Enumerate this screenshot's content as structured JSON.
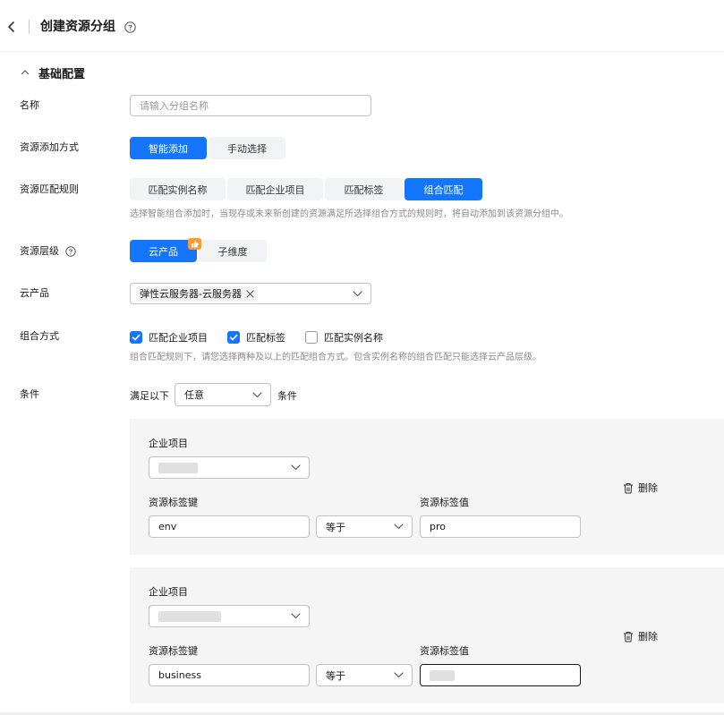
{
  "header": {
    "title": "创建资源分组"
  },
  "section": {
    "title": "基础配置"
  },
  "name": {
    "label": "名称",
    "placeholder": "请输入分组名称"
  },
  "add_method": {
    "label": "资源添加方式",
    "options": [
      "智能添加",
      "手动选择"
    ],
    "selected": "智能添加"
  },
  "match_rule": {
    "label": "资源匹配规则",
    "options": [
      "匹配实例名称",
      "匹配企业项目",
      "匹配标签",
      "组合匹配"
    ],
    "selected": "组合匹配",
    "hint": "选择智能组合添加时，当现存或未来新创建的资源满足所选择组合方式的规则时，将自动添加到该资源分组中。"
  },
  "level": {
    "label": "资源层级",
    "options": [
      "云产品",
      "子维度"
    ],
    "selected": "云产品"
  },
  "cloud_product": {
    "label": "云产品",
    "selected_tag": "弹性云服务器-云服务器"
  },
  "combination": {
    "label": "组合方式",
    "options": [
      {
        "label": "匹配企业项目",
        "checked": true
      },
      {
        "label": "匹配标签",
        "checked": true
      },
      {
        "label": "匹配实例名称",
        "checked": false
      }
    ],
    "hint": "组合匹配规则下，请您选择两种及以上的匹配组合方式。包含实例名称的组合匹配只能选择云产品层级。"
  },
  "condition": {
    "label": "条件",
    "prefix": "满足以下",
    "mode": "任意",
    "suffix": "条件",
    "rules": [
      {
        "ep_label": "企业项目",
        "key_label": "资源标签键",
        "key": "env",
        "operator": "等于",
        "value_label": "资源标签值",
        "value": "pro",
        "delete_label": "删除"
      },
      {
        "ep_label": "企业项目",
        "key_label": "资源标签键",
        "key": "business",
        "operator": "等于",
        "value_label": "资源标签值",
        "value": "",
        "delete_label": "删除"
      }
    ]
  },
  "colors": {
    "primary": "#1476ff",
    "panel": "#f5f5f6",
    "hint": "#8a8a8a",
    "badge": "#ff9a2e"
  }
}
